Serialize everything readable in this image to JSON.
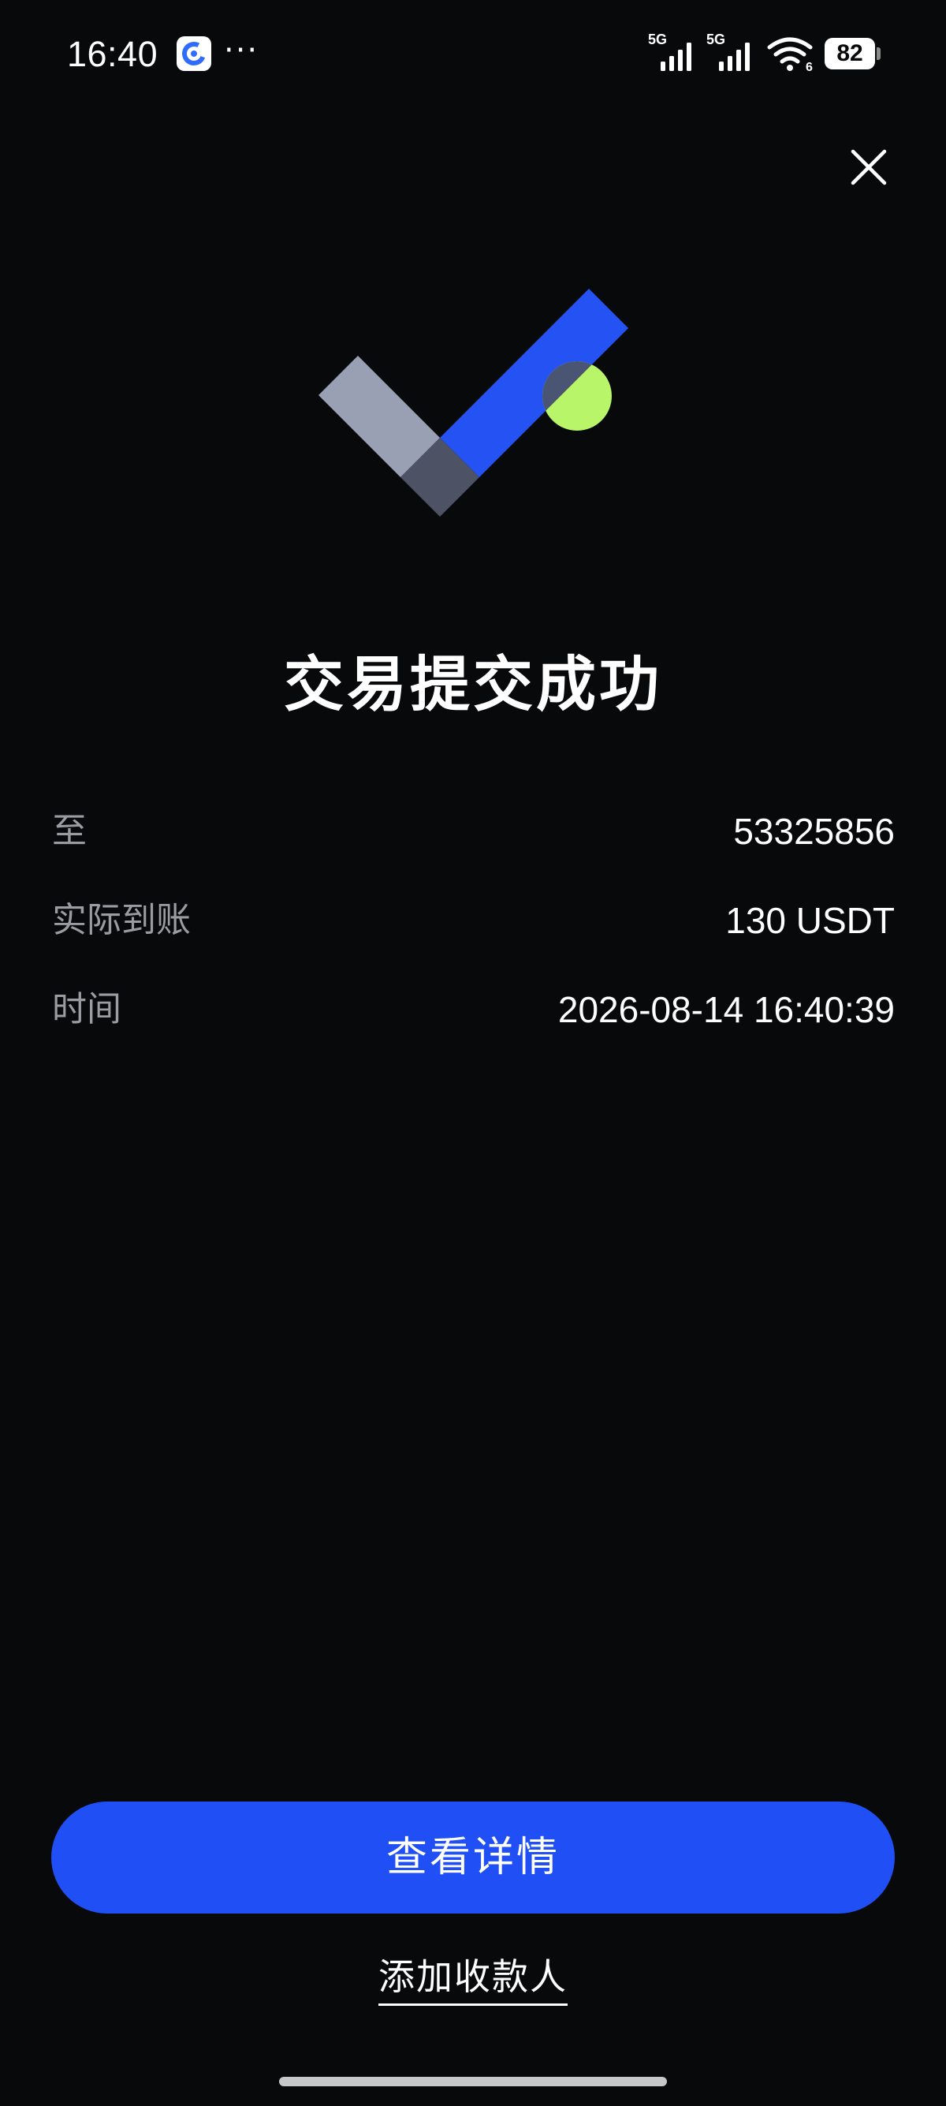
{
  "status_bar": {
    "time": "16:40",
    "app_icon": "app-c-icon",
    "more": "···",
    "net1": "5G",
    "net2": "5G",
    "wifi_badge": "6",
    "battery": "82"
  },
  "icons": {
    "close": "close-icon",
    "success": "success-check-icon"
  },
  "colors": {
    "background": "#08090b",
    "accent_blue": "#2050f5",
    "accent_green": "#b8f568",
    "label_gray": "#9a9ca1"
  },
  "title": "交易提交成功",
  "details": [
    {
      "label": "至",
      "value": "53325856"
    },
    {
      "label": "实际到账",
      "value": "130 USDT"
    },
    {
      "label": "时间",
      "value": "2026-08-14 16:40:39"
    }
  ],
  "actions": {
    "view_details": "查看详情",
    "add_payee": "添加收款人"
  }
}
